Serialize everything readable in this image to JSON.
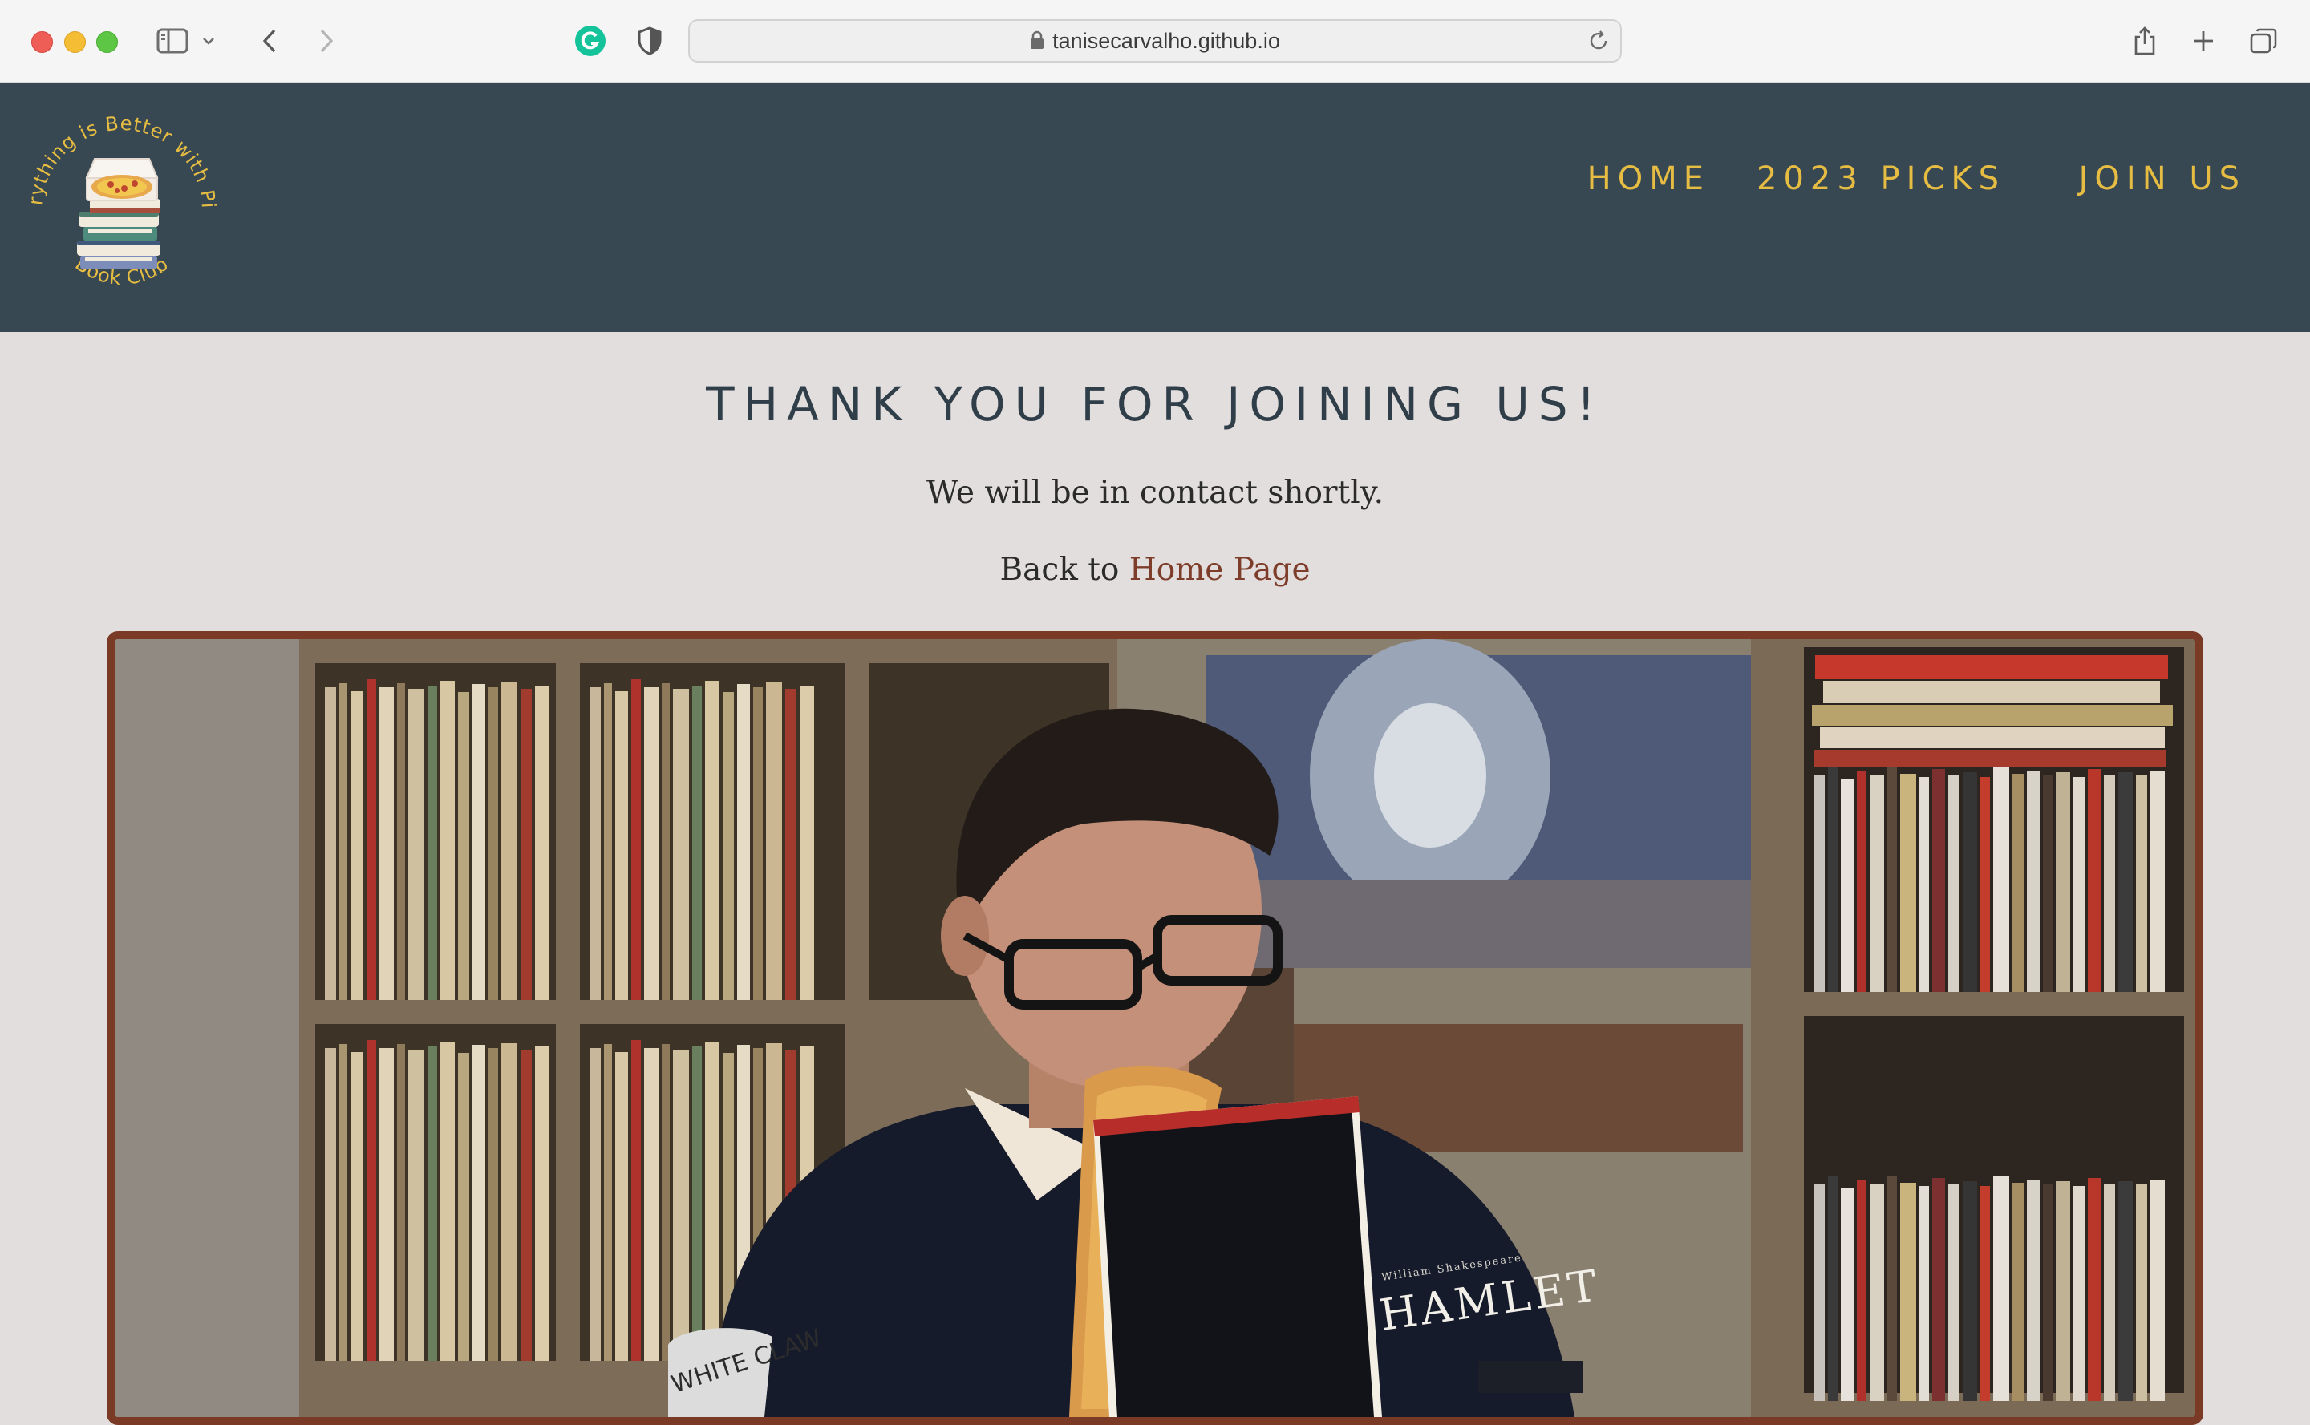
{
  "browser": {
    "url": "tanisecarvalho.github.io"
  },
  "site": {
    "logo": {
      "arc_text": "Everything is Better with Pizza",
      "bottom_text": "Book Club"
    },
    "nav": [
      {
        "label": "HOME"
      },
      {
        "label": "2023 PICKS"
      },
      {
        "label": "JOIN US"
      }
    ]
  },
  "main": {
    "title": "THANK YOU FOR JOINING US!",
    "message": "We will be in contact shortly.",
    "back_prefix": "Back to ",
    "back_link": "Home Page",
    "photo": {
      "book_title": "HAMLET",
      "book_author": "William Shakespeare",
      "can_text": "WHITE CLAW"
    }
  },
  "colors": {
    "header_bg": "#374853",
    "nav_text": "#e6bd42",
    "page_bg": "#e2dedd",
    "heading": "#2f3e49",
    "link": "#7d3d2a",
    "frame": "#7a3a26"
  }
}
